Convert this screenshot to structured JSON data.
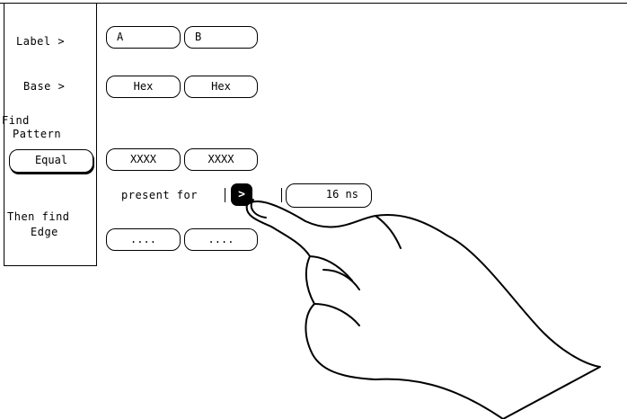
{
  "sidebar": {
    "label_menu": "Label >",
    "base_menu": "Base >",
    "find_pattern_line1": "Find",
    "find_pattern_line2": "Pattern",
    "pattern_mode": "Equal",
    "then_find_line1": "Then find",
    "then_find_line2": "Edge"
  },
  "labels": [
    "A",
    "B"
  ],
  "bases": [
    "Hex",
    "Hex"
  ],
  "patterns": [
    "XXXX",
    "XXXX"
  ],
  "present_for": {
    "text": "present for",
    "qualifier_symbol": ">",
    "duration": "16 ns"
  },
  "edges": [
    "....",
    "...."
  ]
}
